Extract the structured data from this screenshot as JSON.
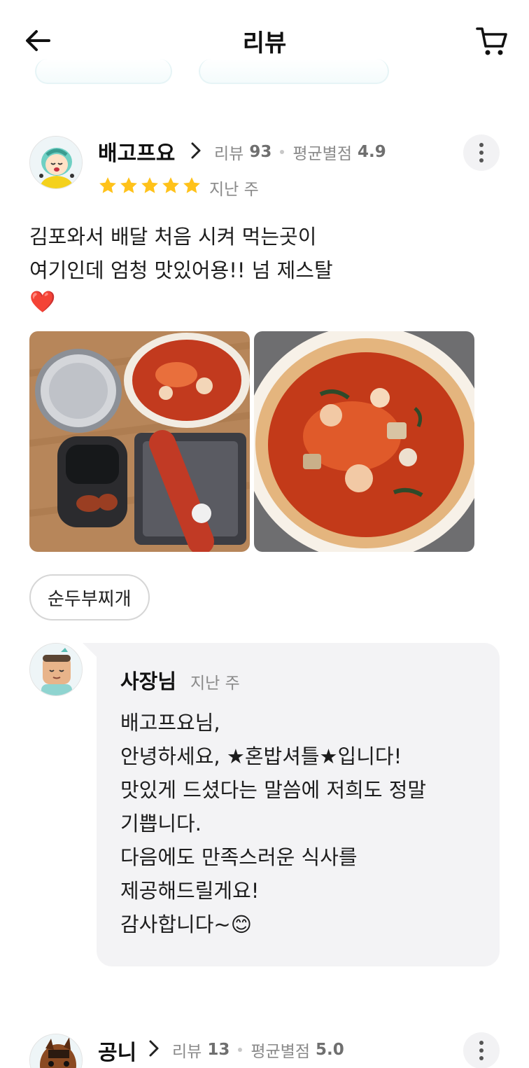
{
  "header": {
    "title": "리뷰",
    "back_icon": "arrow-left-icon",
    "cart_icon": "cart-icon"
  },
  "reviews": [
    {
      "user": "배고프요",
      "review_count_label": "리뷰",
      "review_count": "93",
      "avg_rating_label": "평균별점",
      "avg_rating": "4.9",
      "rating": 5,
      "date": "지난 주",
      "text": "김포와서 배달 처음 시켜 먹는곳이\n여기인데 엄청 맛있어용!! 넘 제스탈",
      "emoji": "❤️",
      "menu_tag": "순두부찌개",
      "reply": {
        "author": "사장님",
        "date": "지난 주",
        "text": "배고프요님,\n안녕하세요, ★혼밥셔틀★입니다!\n맛있게 드셨다는 말씀에 저희도 정말\n기쁩니다.\n다음에도 만족스러운 식사를\n제공해드릴게요!\n감사합니다~😊"
      }
    },
    {
      "user": "공니",
      "review_count_label": "리뷰",
      "review_count": "13",
      "avg_rating_label": "평균별점",
      "avg_rating": "5.0"
    }
  ],
  "colors": {
    "star": "#FFC21A",
    "bubble": "#F3F3F5",
    "meta_text": "#8A8A8A"
  }
}
